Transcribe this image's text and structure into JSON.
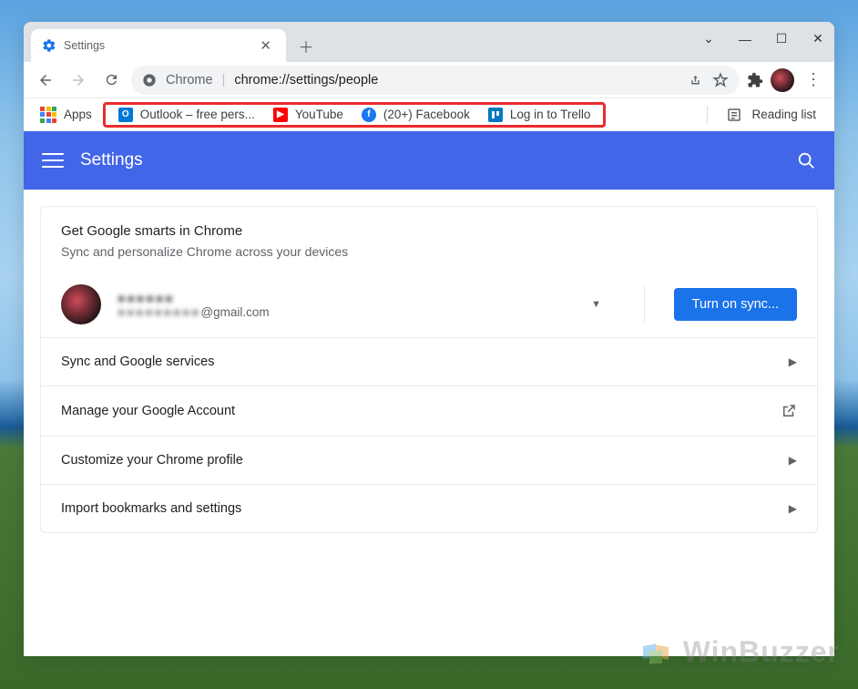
{
  "window": {
    "tab_title": "Settings",
    "url_app": "Chrome",
    "url_path": "chrome://settings/people"
  },
  "bookmarks": {
    "apps_label": "Apps",
    "items": [
      {
        "label": "Outlook – free pers...",
        "icon": "outlook"
      },
      {
        "label": "YouTube",
        "icon": "youtube"
      },
      {
        "label": "(20+) Facebook",
        "icon": "facebook"
      },
      {
        "label": "Log in to Trello",
        "icon": "trello"
      }
    ],
    "reading_list_label": "Reading list"
  },
  "appbar": {
    "title": "Settings"
  },
  "card": {
    "heading": "Get Google smarts in Chrome",
    "subheading": "Sync and personalize Chrome across your devices",
    "account_name_masked": "●●●●●●",
    "account_email_masked_prefix": "●●●●●●●●●",
    "account_email_domain": "@gmail.com",
    "sync_button": "Turn on sync...",
    "rows": [
      {
        "label": "Sync and Google services",
        "kind": "arrow"
      },
      {
        "label": "Manage your Google Account",
        "kind": "external"
      },
      {
        "label": "Customize your Chrome profile",
        "kind": "arrow"
      },
      {
        "label": "Import bookmarks and settings",
        "kind": "arrow"
      }
    ]
  },
  "watermark": "WinBuzzer"
}
